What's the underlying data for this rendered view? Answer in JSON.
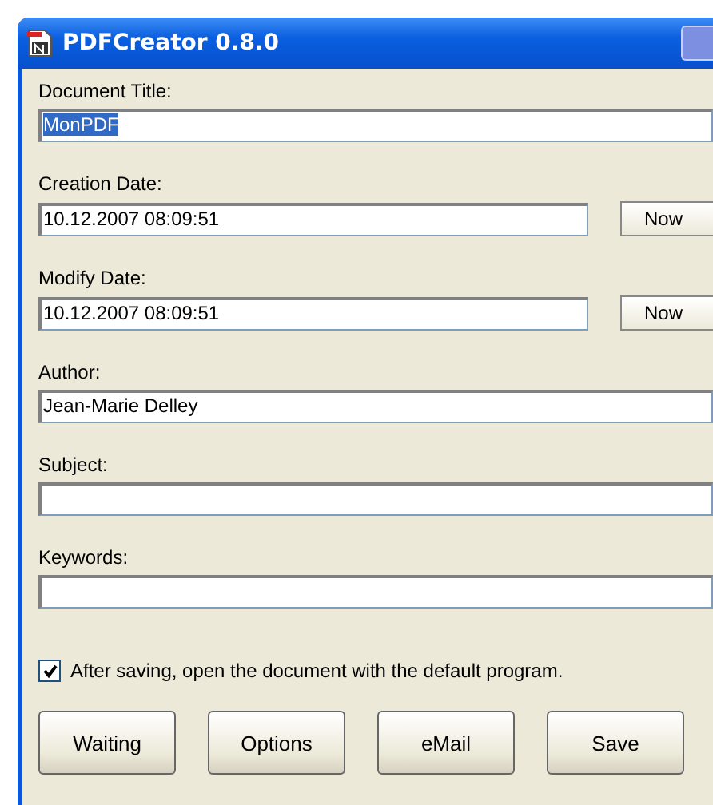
{
  "window": {
    "title": "PDFCreator 0.8.0"
  },
  "fields": [
    {
      "label": "Document Title:",
      "value": "MonPDF",
      "text_selected": true
    },
    {
      "label": "Creation Date:",
      "value": "10.12.2007 08:09:51",
      "text_selected": false,
      "button": "Now"
    },
    {
      "label": "Modify Date:",
      "value": "10.12.2007 08:09:51",
      "text_selected": false,
      "button": "Now"
    },
    {
      "label": "Author:",
      "value": "Jean-Marie Delley",
      "text_selected": false
    },
    {
      "label": "Subject:"
    },
    {
      "label": "Keywords:"
    }
  ],
  "open_after_saving": {
    "label": "After saving, open the document with the default program.",
    "checked": true
  },
  "buttons": [
    "Waiting",
    "Options",
    "eMail",
    "Save"
  ]
}
